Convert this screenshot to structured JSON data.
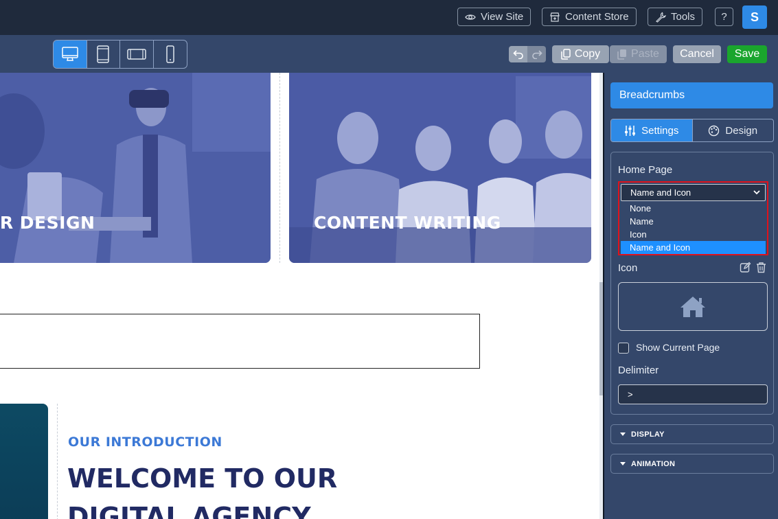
{
  "topbar": {
    "view_site": "View Site",
    "content_store": "Content Store",
    "tools": "Tools",
    "help": "?",
    "avatar_initial": "S"
  },
  "toolbar": {
    "devices": [
      "desktop",
      "tablet-portrait",
      "tablet-landscape",
      "mobile"
    ],
    "active_device": "desktop",
    "copy": "Copy",
    "paste": "Paste",
    "cancel": "Cancel",
    "save": "Save"
  },
  "canvas": {
    "card_left_title": "VR DESIGN",
    "card_right_title": "CONTENT WRITING",
    "intro_label": "OUR INTRODUCTION",
    "intro_title": "WELCOME TO OUR DIGITAL AGENCY"
  },
  "panel": {
    "title": "Breadcrumbs",
    "tab_settings": "Settings",
    "tab_design": "Design",
    "home_page_label": "Home Page",
    "home_page_value": "Name and Icon",
    "home_page_options": [
      "None",
      "Name",
      "Icon",
      "Name and Icon"
    ],
    "icon_label": "Icon",
    "show_current_page": "Show Current Page",
    "delimiter_label": "Delimiter",
    "delimiter_value": ">",
    "display": "DISPLAY",
    "animation": "ANIMATION"
  },
  "colors": {
    "accent": "#2e8ae6",
    "save": "#1aa52d",
    "highlight": "#e0121b",
    "selected_option": "#1e90ff"
  }
}
